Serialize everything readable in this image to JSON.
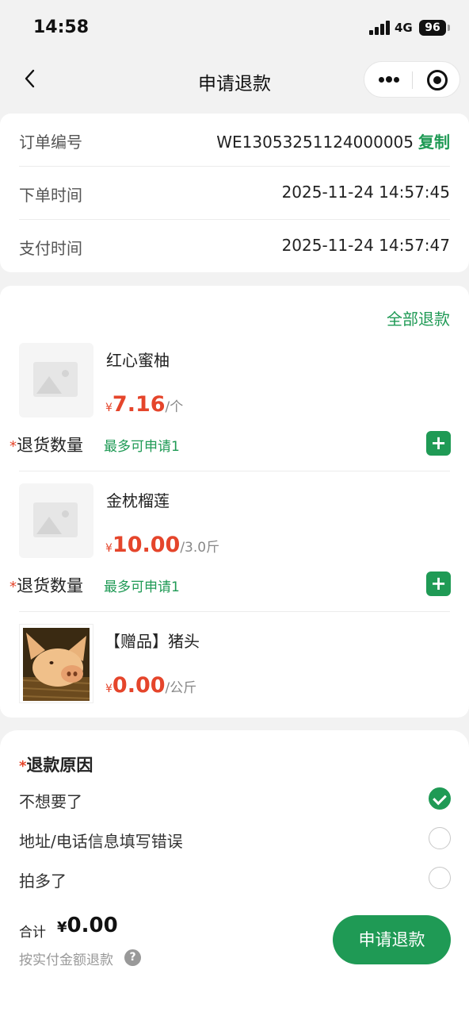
{
  "status_bar": {
    "time": "14:58",
    "network": "4G",
    "battery": "96"
  },
  "nav": {
    "title": "申请退款"
  },
  "order": {
    "number_label": "订单编号",
    "number_value": "WE13053251124000005",
    "copy_label": "复制",
    "order_time_label": "下单时间",
    "order_time_value": "2025-11-24 14:57:45",
    "pay_time_label": "支付时间",
    "pay_time_value": "2025-11-24 14:57:47"
  },
  "products_section": {
    "refund_all_label": "全部退款"
  },
  "products": [
    {
      "name": "红心蜜柚",
      "yen": "¥",
      "price": "7.16",
      "unit": "/个",
      "qty_required": "*",
      "qty_label": "退货数量",
      "qty_hint": "最多可申请1",
      "add_label": "+"
    },
    {
      "name": "金枕榴莲",
      "yen": "¥",
      "price": "10.00",
      "unit": "/3.0斤",
      "qty_required": "*",
      "qty_label": "退货数量",
      "qty_hint": "最多可申请1",
      "add_label": "+"
    },
    {
      "name": "【赠品】猪头",
      "yen": "¥",
      "price": "0.00",
      "unit": "/公斤"
    }
  ],
  "reasons": {
    "required": "*",
    "title": "退款原因",
    "options": [
      {
        "label": "不想要了",
        "checked": true
      },
      {
        "label": "地址/电话信息填写错误",
        "checked": false
      },
      {
        "label": "拍多了",
        "checked": false
      }
    ]
  },
  "footer": {
    "total_label": "合计",
    "total_yen": "¥",
    "total_value": "0.00",
    "note": "按实付金额退款",
    "help_icon": "?",
    "submit_label": "申请退款"
  },
  "colors": {
    "accent": "#1f9a55",
    "price": "#e5452b",
    "background": "#f2f2f2"
  }
}
